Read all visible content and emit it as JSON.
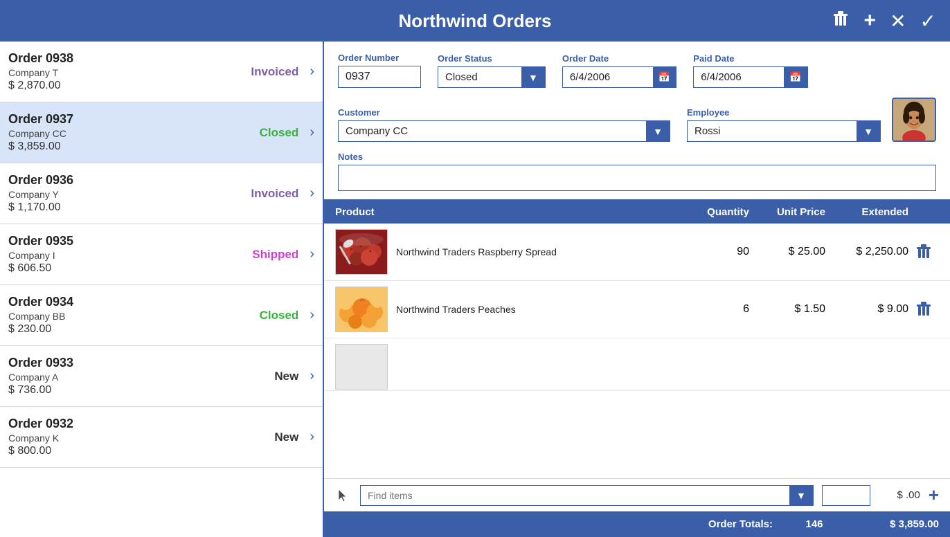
{
  "app": {
    "title": "Northwind Orders"
  },
  "header": {
    "delete_label": "🗑",
    "add_label": "+",
    "cancel_label": "✕",
    "confirm_label": "✓"
  },
  "orders": [
    {
      "id": "0938",
      "company": "Company T",
      "amount": "$ 2,870.00",
      "status": "Invoiced",
      "status_class": "status-invoiced"
    },
    {
      "id": "0937",
      "company": "Company CC",
      "amount": "$ 3,859.00",
      "status": "Closed",
      "status_class": "status-closed",
      "selected": true
    },
    {
      "id": "0936",
      "company": "Company Y",
      "amount": "$ 1,170.00",
      "status": "Invoiced",
      "status_class": "status-invoiced"
    },
    {
      "id": "0935",
      "company": "Company I",
      "amount": "$ 606.50",
      "status": "Shipped",
      "status_class": "status-shipped"
    },
    {
      "id": "0934",
      "company": "Company BB",
      "amount": "$ 230.00",
      "status": "Closed",
      "status_class": "status-closed"
    },
    {
      "id": "0933",
      "company": "Company A",
      "amount": "$ 736.00",
      "status": "New",
      "status_class": "status-new"
    },
    {
      "id": "0932",
      "company": "Company K",
      "amount": "$ 800.00",
      "status": "New",
      "status_class": "status-new"
    }
  ],
  "detail": {
    "order_number_label": "Order Number",
    "order_number": "0937",
    "order_status_label": "Order Status",
    "order_status": "Closed",
    "order_date_label": "Order Date",
    "order_date": "6/4/2006",
    "paid_date_label": "Paid Date",
    "paid_date": "6/4/2006",
    "customer_label": "Customer",
    "customer": "Company CC",
    "employee_label": "Employee",
    "employee": "Rossi",
    "notes_label": "Notes",
    "notes": ""
  },
  "products": {
    "col_product": "Product",
    "col_quantity": "Quantity",
    "col_unit_price": "Unit Price",
    "col_extended": "Extended",
    "items": [
      {
        "name": "Northwind Traders Raspberry Spread",
        "quantity": 90,
        "unit_price": "$ 25.00",
        "extended": "$ 2,250.00",
        "thumb_type": "raspberry"
      },
      {
        "name": "Northwind Traders Peaches",
        "quantity": 6,
        "unit_price": "$ 1.50",
        "extended": "$ 9.00",
        "thumb_type": "peaches"
      }
    ]
  },
  "find_items": {
    "placeholder": "Find items",
    "price_display": "$ .00",
    "add_label": "+"
  },
  "totals": {
    "label": "Order Totals:",
    "quantity": "146",
    "amount": "$ 3,859.00"
  }
}
